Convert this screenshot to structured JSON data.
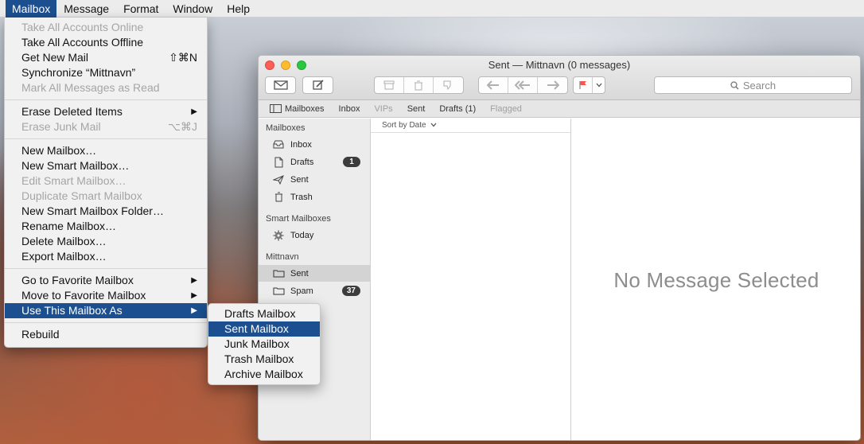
{
  "menubar": {
    "items": [
      "Mailbox",
      "Message",
      "Format",
      "Window",
      "Help"
    ]
  },
  "mailbox_menu": {
    "groups": [
      [
        {
          "label": "Take All Accounts Online",
          "enabled": false
        },
        {
          "label": "Take All Accounts Offline",
          "enabled": true
        },
        {
          "label": "Get New Mail",
          "enabled": true,
          "shortcut": "⇧⌘N"
        },
        {
          "label": "Synchronize “Mittnavn”",
          "enabled": true
        },
        {
          "label": "Mark All Messages as Read",
          "enabled": false
        }
      ],
      [
        {
          "label": "Erase Deleted Items",
          "enabled": true,
          "submenu": true
        },
        {
          "label": "Erase Junk Mail",
          "enabled": false,
          "shortcut": "⌥⌘J"
        }
      ],
      [
        {
          "label": "New Mailbox…",
          "enabled": true
        },
        {
          "label": "New Smart Mailbox…",
          "enabled": true
        },
        {
          "label": "Edit Smart Mailbox…",
          "enabled": false
        },
        {
          "label": "Duplicate Smart Mailbox",
          "enabled": false
        },
        {
          "label": "New Smart Mailbox Folder…",
          "enabled": true
        },
        {
          "label": "Rename Mailbox…",
          "enabled": true
        },
        {
          "label": "Delete Mailbox…",
          "enabled": true
        },
        {
          "label": "Export Mailbox…",
          "enabled": true
        }
      ],
      [
        {
          "label": "Go to Favorite Mailbox",
          "enabled": true,
          "submenu": true
        },
        {
          "label": "Move to Favorite Mailbox",
          "enabled": true,
          "submenu": true
        },
        {
          "label": "Use This Mailbox As",
          "enabled": true,
          "submenu": true,
          "highlighted": true
        }
      ],
      [
        {
          "label": "Rebuild",
          "enabled": true
        }
      ]
    ]
  },
  "use_as_submenu": {
    "items": [
      "Drafts Mailbox",
      "Sent Mailbox",
      "Junk Mailbox",
      "Trash Mailbox",
      "Archive Mailbox"
    ],
    "highlighted_index": 1
  },
  "window": {
    "title": "Sent — Mittnavn (0 messages)",
    "search_placeholder": "Search",
    "favorites": [
      "Mailboxes",
      "Inbox",
      "VIPs",
      "Sent",
      "Drafts (1)",
      "Flagged"
    ],
    "sort_label": "Sort by Date",
    "empty_preview": "No Message Selected"
  },
  "sidebar": {
    "mailboxes_header": "Mailboxes",
    "mailboxes": [
      {
        "label": "Inbox",
        "icon": "inbox-tray-icon"
      },
      {
        "label": "Drafts",
        "icon": "document-icon",
        "badge": "1"
      },
      {
        "label": "Sent",
        "icon": "paper-plane-icon"
      },
      {
        "label": "Trash",
        "icon": "trash-icon"
      }
    ],
    "smart_header": "Smart Mailboxes",
    "smart": [
      {
        "label": "Today",
        "icon": "gear-icon"
      }
    ],
    "account_header": "Mittnavn",
    "account": [
      {
        "label": "Sent",
        "icon": "folder-icon",
        "selected": true
      },
      {
        "label": "Spam",
        "icon": "folder-icon",
        "badge": "37"
      }
    ]
  },
  "colors": {
    "menu_highlight": "#1c4f8f",
    "flag_red": "#f2584f"
  }
}
